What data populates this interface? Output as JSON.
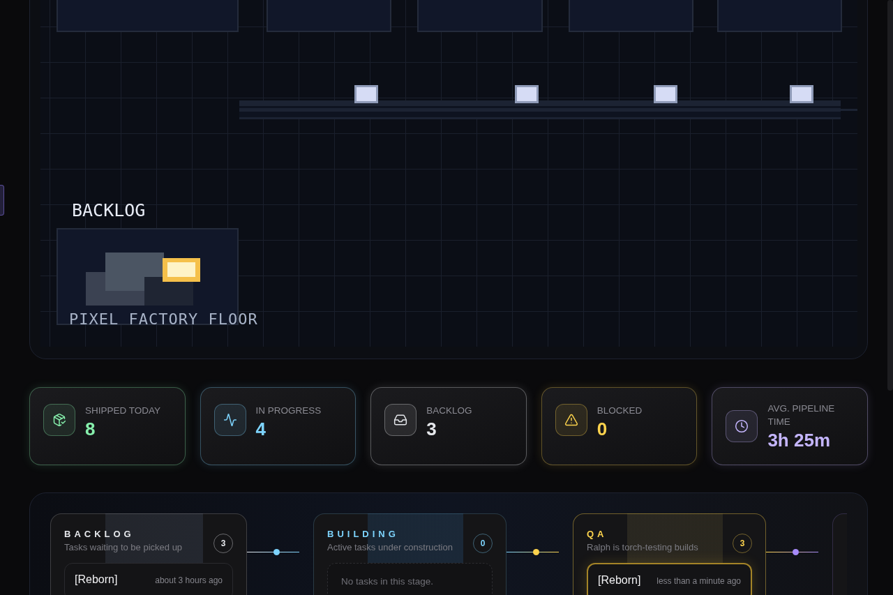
{
  "factory_floor": {
    "station_label": "BACKLOG",
    "caption": "PIXEL FACTORY FLOOR"
  },
  "stats": [
    {
      "label": "SHIPPED TODAY",
      "value": "8",
      "color": "#86efac"
    },
    {
      "label": "IN PROGRESS",
      "value": "4",
      "color": "#7dd3fc"
    },
    {
      "label": "BACKLOG",
      "value": "3",
      "color": "#e5e7eb"
    },
    {
      "label": "BLOCKED",
      "value": "0",
      "color": "#fcd34d"
    },
    {
      "label": "AVG. PIPELINE TIME",
      "value": "3h 25m",
      "color": "#c4b5fd"
    }
  ],
  "pipeline": {
    "stages": [
      {
        "title": "BACKLOG",
        "subtitle": "Tasks waiting to be picked up",
        "count": "3",
        "color": "#e5e7eb",
        "tasks": [
          {
            "title": "[Reborn]",
            "time": "about 3 hours ago",
            "highlighted": false
          }
        ]
      },
      {
        "title": "BUILDING",
        "subtitle": "Active tasks under construction",
        "count": "0",
        "color": "#7dd3fc",
        "empty_text": "No tasks in this stage."
      },
      {
        "title": "QA",
        "subtitle": "Ralph is torch-testing builds",
        "count": "3",
        "color": "#fcd34d",
        "tasks": [
          {
            "title": "[Reborn]",
            "time": "less than a minute ago",
            "highlighted": true
          }
        ]
      },
      {
        "color": "#a78bfa"
      }
    ]
  }
}
